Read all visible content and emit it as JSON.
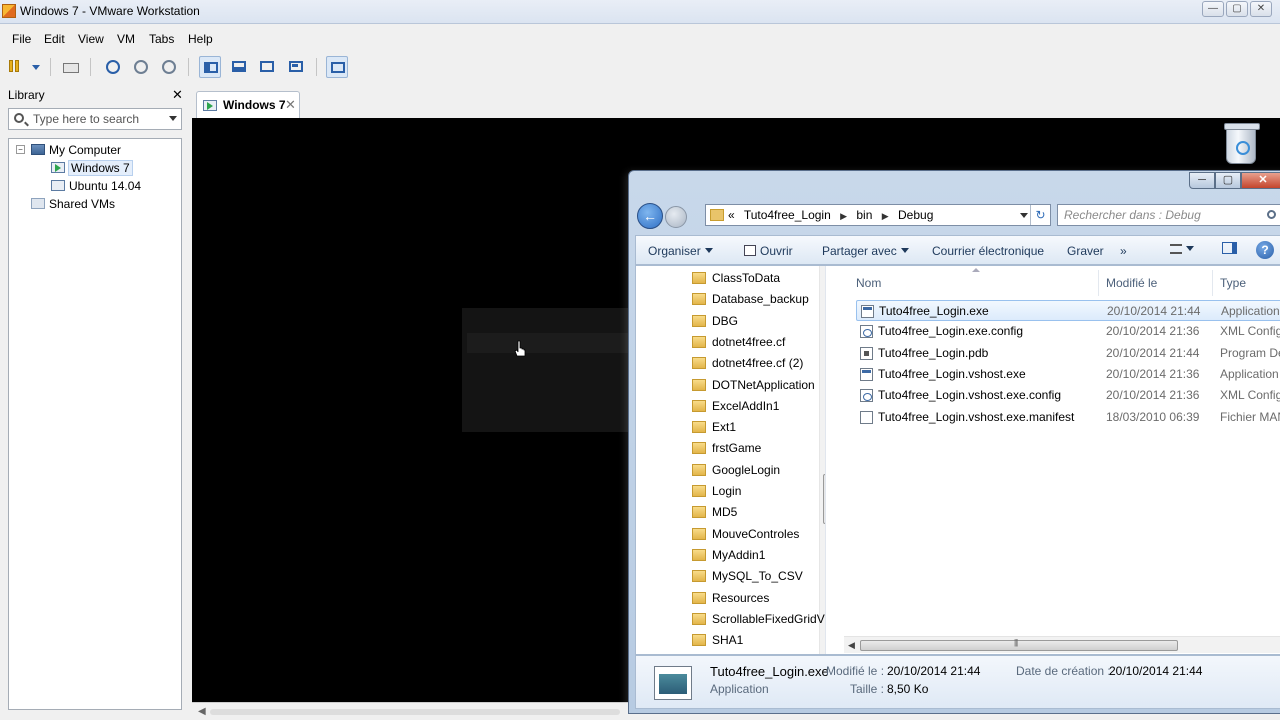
{
  "app": {
    "title": "Windows 7 - VMware Workstation",
    "controls": [
      "—",
      "▢",
      "✕"
    ]
  },
  "menu": [
    "File",
    "Edit",
    "View",
    "VM",
    "Tabs",
    "Help"
  ],
  "toolbar": {
    "buttons": [
      "pause-icon",
      "send-ctrl-alt-del-icon",
      "snapshot-icon",
      "revert-snapshot-icon",
      "snapshot-manager-icon",
      "show-library-icon",
      "show-thumbnails-icon",
      "fullscreen-icon",
      "unity-icon",
      "console-view-icon"
    ]
  },
  "library": {
    "title": "Library",
    "close": "✕",
    "search_placeholder": "Type here to search",
    "tree": {
      "root": "My Computer",
      "expander": "−",
      "vms": [
        "Windows 7",
        "Ubuntu 14.04"
      ],
      "shared": "Shared VMs"
    }
  },
  "tabs": [
    {
      "label": "Windows 7",
      "close": "✕"
    }
  ],
  "explorer": {
    "controls": {
      "min": "─",
      "max": "▢",
      "close": "✕"
    },
    "address": {
      "overflow": "«",
      "crumbs": [
        "Tuto4free_Login",
        "bin",
        "Debug"
      ],
      "sep": "▶",
      "refresh": "↻"
    },
    "search_placeholder": "Rechercher dans : Debug",
    "commands": {
      "organize": "Organiser",
      "open": "Ouvrir",
      "share": "Partager avec",
      "email": "Courrier électronique",
      "burn": "Graver",
      "more": "»",
      "help": "?"
    },
    "nav_folders": [
      "ClassToData",
      "Database_backup",
      "DBG",
      "dotnet4free.cf",
      "dotnet4free.cf (2)",
      "DOTNetApplication",
      "ExcelAddIn1",
      "Ext1",
      "frstGame",
      "GoogleLogin",
      "Login",
      "MD5",
      "MouveControles",
      "MyAddin1",
      "MySQL_To_CSV",
      "Resources",
      "ScrollableFixedGridVie",
      "SHA1"
    ],
    "columns": {
      "name": "Nom",
      "modified": "Modifié le",
      "type": "Type"
    },
    "files": [
      {
        "name": "Tuto4free_Login.exe",
        "date": "20/10/2014 21:44",
        "type": "Application",
        "icon": "exe"
      },
      {
        "name": "Tuto4free_Login.exe.config",
        "date": "20/10/2014 21:36",
        "type": "XML Configu",
        "icon": "cfg"
      },
      {
        "name": "Tuto4free_Login.pdb",
        "date": "20/10/2014 21:44",
        "type": "Program Del",
        "icon": "pdb"
      },
      {
        "name": "Tuto4free_Login.vshost.exe",
        "date": "20/10/2014 21:36",
        "type": "Application",
        "icon": "exe"
      },
      {
        "name": "Tuto4free_Login.vshost.exe.config",
        "date": "20/10/2014 21:36",
        "type": "XML Configu",
        "icon": "cfg"
      },
      {
        "name": "Tuto4free_Login.vshost.exe.manifest",
        "date": "18/03/2010 06:39",
        "type": "Fichier MAN",
        "icon": "blank"
      }
    ],
    "details": {
      "name": "Tuto4free_Login.exe",
      "kind": "Application",
      "modified_label": "Modifié le :",
      "modified_value": "20/10/2014 21:44",
      "size_label": "Taille :",
      "size_value": "8,50 Ko",
      "created_label": "Date de création :",
      "created_value": "20/10/2014 21:44"
    }
  },
  "colors": {
    "accent": "#2a5fa8",
    "selection": "#dcebfc",
    "guest_bg": "#000000"
  }
}
